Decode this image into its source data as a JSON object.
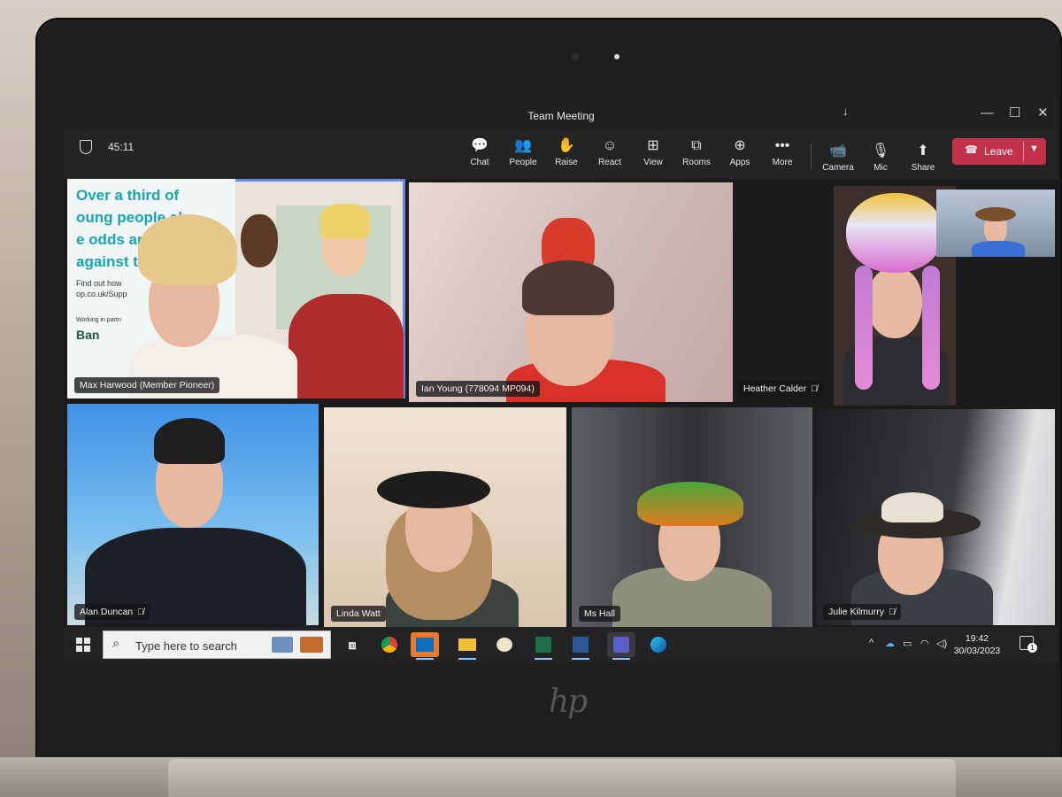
{
  "window": {
    "title": "Team Meeting",
    "controls": {
      "minimize": "—",
      "maximize": "☐",
      "close": "✕"
    }
  },
  "meeting": {
    "duration": "45:11"
  },
  "toolbar": {
    "items": [
      {
        "label": "Chat",
        "icon": "chat-icon",
        "glyph": "💬"
      },
      {
        "label": "People",
        "icon": "people-icon",
        "glyph": "👥"
      },
      {
        "label": "Raise",
        "icon": "raise-hand-icon",
        "glyph": "✋"
      },
      {
        "label": "React",
        "icon": "react-icon",
        "glyph": "☺"
      },
      {
        "label": "View",
        "icon": "view-grid-icon",
        "glyph": "⊞"
      },
      {
        "label": "Rooms",
        "icon": "rooms-icon",
        "glyph": "⧉"
      },
      {
        "label": "Apps",
        "icon": "apps-icon",
        "glyph": "⊕"
      },
      {
        "label": "More",
        "icon": "more-icon",
        "glyph": "•••"
      },
      {
        "label": "Camera",
        "icon": "camera-icon",
        "glyph": "📹"
      },
      {
        "label": "Mic",
        "icon": "mic-icon",
        "glyph": "🎙"
      },
      {
        "label": "Share",
        "icon": "share-icon",
        "glyph": "⬆"
      }
    ],
    "leave_label": "Leave",
    "leave_color": "#c4314b"
  },
  "participants": [
    {
      "name": "Max Harwood (Member Pioneer)",
      "muted": false,
      "speaking": true
    },
    {
      "name": "Ian Young (778094 MP094)",
      "muted": false,
      "speaking": true
    },
    {
      "name": "Heather Calder",
      "muted": true,
      "speaking": false
    },
    {
      "name": "Alan Duncan",
      "muted": true,
      "speaking": false
    },
    {
      "name": "Linda Watt",
      "muted": false,
      "speaking": true
    },
    {
      "name": "Ms Hall",
      "muted": false,
      "speaking": true
    },
    {
      "name": "Julie Kilmurry",
      "muted": true,
      "speaking": false
    }
  ],
  "poster": {
    "headline": [
      "Over a third of",
      "oung people  el",
      "e odds are  s  d",
      "against t"
    ],
    "find_out": "Find out how",
    "url": "op.co.uk/Supp",
    "working": "Working in partn",
    "bank": "Ban"
  },
  "taskbar": {
    "search_placeholder": "Type here to search",
    "apps": [
      "task-view",
      "chrome",
      "outlook",
      "file-explorer",
      "paint",
      "excel",
      "word",
      "teams",
      "edge"
    ],
    "time": "19:42",
    "date": "30/03/2023",
    "notification_count": "1"
  },
  "device": {
    "brand": "hp"
  }
}
